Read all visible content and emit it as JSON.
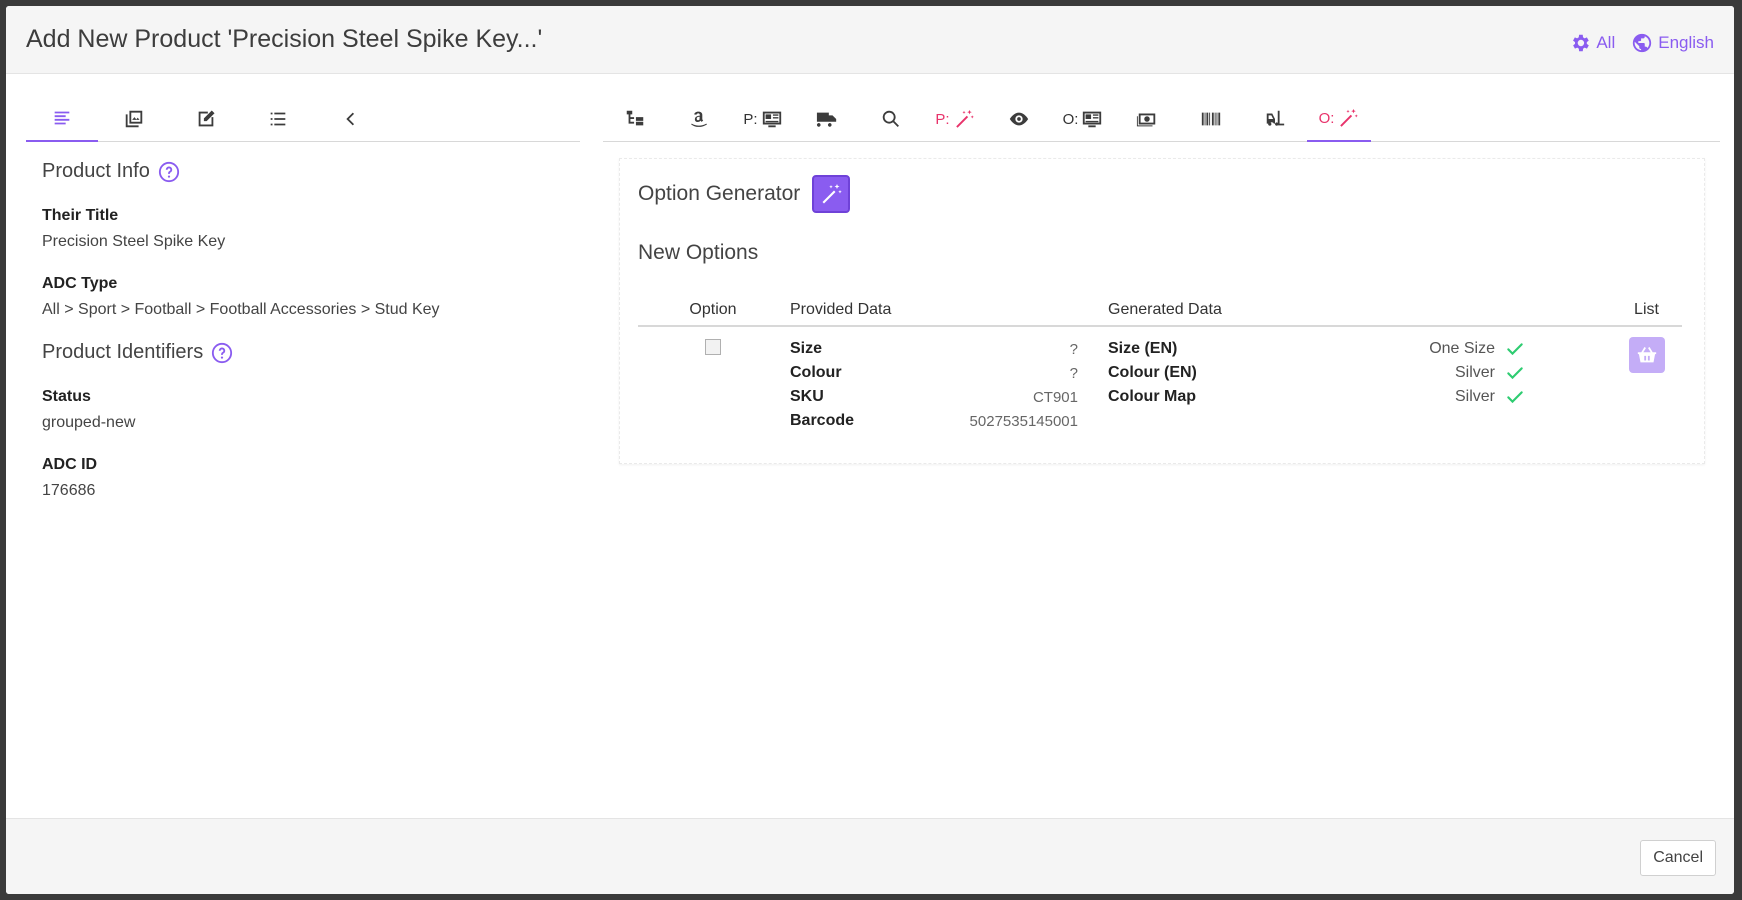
{
  "modal": {
    "title": "Add New Product 'Precision Steel Spike Key...'",
    "header_links": {
      "all_label": "All",
      "language_label": "English"
    }
  },
  "left_tabs": [
    {
      "icon": "align-left-icon",
      "active": true
    },
    {
      "icon": "image-gallery-icon",
      "active": false
    },
    {
      "icon": "edit-icon",
      "active": false
    },
    {
      "icon": "list-icon",
      "active": false
    },
    {
      "icon": "chevron-left-icon",
      "active": false
    }
  ],
  "product_info": {
    "title": "Product Info",
    "their_title_label": "Their Title",
    "their_title_value": "Precision Steel Spike Key",
    "adc_type_label": "ADC Type",
    "adc_type_value": "All > Sport > Football > Football Accessories > Stud Key"
  },
  "product_identifiers": {
    "title": "Product Identifiers",
    "status_label": "Status",
    "status_value": "grouped-new",
    "adc_id_label": "ADC ID",
    "adc_id_value": "176686"
  },
  "right_tabs": [
    {
      "icon": "category-tree-icon",
      "prefix": "",
      "active": false
    },
    {
      "icon": "amazon-icon",
      "prefix": "",
      "active": false
    },
    {
      "icon": "listing-card-icon",
      "prefix": "P:",
      "prefix_color": "dark",
      "active": false
    },
    {
      "icon": "truck-icon",
      "prefix": "",
      "active": false
    },
    {
      "icon": "search-icon",
      "prefix": "",
      "active": false
    },
    {
      "icon": "magic-wand-icon",
      "prefix": "P:",
      "prefix_color": "pink",
      "active": false
    },
    {
      "icon": "eye-icon",
      "prefix": "",
      "active": false
    },
    {
      "icon": "listing-card-icon",
      "prefix": "O:",
      "prefix_color": "dark",
      "active": false
    },
    {
      "icon": "money-icon",
      "prefix": "",
      "active": false
    },
    {
      "icon": "barcode-icon",
      "prefix": "",
      "active": false
    },
    {
      "icon": "forklift-icon",
      "prefix": "",
      "active": false
    },
    {
      "icon": "magic-wand-icon",
      "prefix": "O:",
      "prefix_color": "pink",
      "active": true
    }
  ],
  "option_generator": {
    "title": "Option Generator",
    "new_options_title": "New Options",
    "columns": {
      "option": "Option",
      "provided": "Provided Data",
      "generated": "Generated Data",
      "list": "List"
    },
    "rows": [
      {
        "provided": [
          {
            "key": "Size",
            "value": "?"
          },
          {
            "key": "Colour",
            "value": "?"
          },
          {
            "key": "SKU",
            "value": "CT901"
          },
          {
            "key": "Barcode",
            "value": "5027535145001"
          }
        ],
        "generated": [
          {
            "key": "Size (EN)",
            "value": "One Size"
          },
          {
            "key": "Colour (EN)",
            "value": "Silver"
          },
          {
            "key": "Colour Map",
            "value": "Silver"
          }
        ]
      }
    ]
  },
  "footer": {
    "cancel_label": "Cancel"
  },
  "colors": {
    "accent": "#8a5cf0",
    "pink": "#e8336b",
    "check": "#2ecc71"
  }
}
